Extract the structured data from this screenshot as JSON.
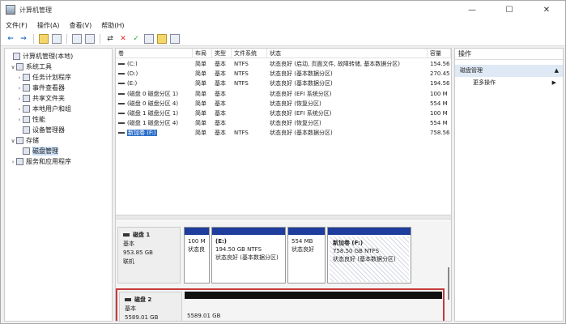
{
  "window": {
    "title": "计算机管理",
    "controls": [
      "—",
      "☐",
      "✕"
    ]
  },
  "menu": [
    "文件(F)",
    "操作(A)",
    "查看(V)",
    "帮助(H)"
  ],
  "tree": {
    "items": [
      {
        "label": "计算机管理(本地)",
        "toggle": ""
      },
      {
        "label": "系统工具",
        "toggle": "∨"
      },
      {
        "label": "任务计划程序",
        "toggle": "›"
      },
      {
        "label": "事件查看器",
        "toggle": "›"
      },
      {
        "label": "共享文件夹",
        "toggle": "›"
      },
      {
        "label": "本地用户和组",
        "toggle": "›"
      },
      {
        "label": "性能",
        "toggle": "›"
      },
      {
        "label": "设备管理器",
        "toggle": ""
      },
      {
        "label": "存储",
        "toggle": "∨"
      },
      {
        "label": "磁盘管理",
        "toggle": ""
      },
      {
        "label": "服务和应用程序",
        "toggle": "›"
      }
    ]
  },
  "volumes": {
    "headers": [
      "卷",
      "布局",
      "类型",
      "文件系统",
      "状态",
      "容量"
    ],
    "rows": [
      {
        "name": "(C:)",
        "layout": "简单",
        "type": "基本",
        "fs": "NTFS",
        "status": "状态良好 (启动, 页面文件, 故障转储, 基本数据分区)",
        "capacity": "154.56"
      },
      {
        "name": "(D:)",
        "layout": "简单",
        "type": "基本",
        "fs": "NTFS",
        "status": "状态良好 (基本数据分区)",
        "capacity": "270.45"
      },
      {
        "name": "(E:)",
        "layout": "简单",
        "type": "基本",
        "fs": "NTFS",
        "status": "状态良好 (基本数据分区)",
        "capacity": "194.56"
      },
      {
        "name": "(磁盘 0 磁盘分区 1)",
        "layout": "简单",
        "type": "基本",
        "fs": "",
        "status": "状态良好 (EFI 系统分区)",
        "capacity": "100 M"
      },
      {
        "name": "(磁盘 0 磁盘分区 4)",
        "layout": "简单",
        "type": "基本",
        "fs": "",
        "status": "状态良好 (恢复分区)",
        "capacity": "554 M"
      },
      {
        "name": "(磁盘 1 磁盘分区 1)",
        "layout": "简单",
        "type": "基本",
        "fs": "",
        "status": "状态良好 (EFI 系统分区)",
        "capacity": "100 M"
      },
      {
        "name": "(磁盘 1 磁盘分区 4)",
        "layout": "简单",
        "type": "基本",
        "fs": "",
        "status": "状态良好 (恢复分区)",
        "capacity": "554 M"
      },
      {
        "name": "新加卷 (F:)",
        "layout": "简单",
        "type": "基本",
        "fs": "NTFS",
        "status": "状态良好 (基本数据分区)",
        "capacity": "758.56"
      }
    ]
  },
  "disk1": {
    "name": "磁盘 1",
    "type": "基本",
    "size": "953.85 GB",
    "state": "联机",
    "partitions": [
      {
        "name": "",
        "size": "100 M",
        "status": "状态良"
      },
      {
        "name": "(E:)",
        "size": "194.50 GB NTFS",
        "status": "状态良好 (基本数据分区)"
      },
      {
        "name": "",
        "size": "554 MB",
        "status": "状态良好"
      },
      {
        "name": "新加卷 (F:)",
        "size": "758.50 GB NTFS",
        "status": "状态良好 (基本数据分区)"
      }
    ]
  },
  "disk2": {
    "name": "磁盘 2",
    "type": "基本",
    "size": "5589.01 GB",
    "capacity_label": "5589.01 GB"
  },
  "actions": {
    "header": "操作",
    "section": "磁盘管理",
    "item": "更多操作"
  },
  "colors": {
    "partition_bar": "#1f3d9c",
    "selection": "#2a6fc9",
    "highlight_frame": "#c63a3a"
  }
}
